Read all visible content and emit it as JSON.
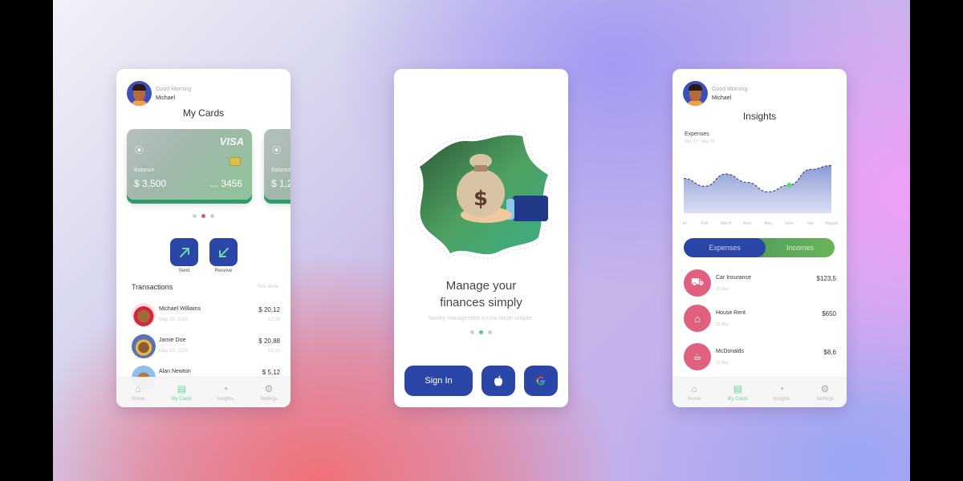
{
  "colors": {
    "primary": "#2a46a6",
    "accent_green": "#6ad8a0",
    "expense_pink": "#e06080",
    "active_dot_pink": "#d0607a",
    "active_dot_green": "#5ac890"
  },
  "screen1": {
    "greeting": "Good Morning",
    "user": "Michael",
    "title": "My Cards",
    "cards": [
      {
        "brand": "VISA",
        "balance_label": "Balance",
        "balance": "$ 3,500",
        "number": "... 3456"
      },
      {
        "brand": "",
        "balance_label": "Balance",
        "balance": "$ 1,2",
        "number": ""
      }
    ],
    "pager": {
      "count": 3,
      "active": 1
    },
    "actions": [
      {
        "label": "Send",
        "icon": "arrow-up-right-icon"
      },
      {
        "label": "Receive",
        "icon": "arrow-down-left-icon"
      }
    ],
    "transactions_title": "Transactions",
    "see_more": "See More",
    "transactions": [
      {
        "name": "Michael Williams",
        "date": "May 25, 2021",
        "amount": "$ 20,12",
        "time": "12:35"
      },
      {
        "name": "Jamie Doe",
        "date": "May 23, 2021",
        "amount": "$ 20,88",
        "time": "15:10"
      },
      {
        "name": "Alan Newton",
        "date": "",
        "amount": "$ 5,12",
        "time": ""
      }
    ],
    "nav": [
      {
        "label": "Home",
        "icon": "home-icon"
      },
      {
        "label": "My Cards",
        "icon": "card-icon",
        "active": true
      },
      {
        "label": "Insights",
        "icon": "pie-chart-icon"
      },
      {
        "label": "Settings",
        "icon": "gear-icon"
      }
    ]
  },
  "screen2": {
    "headline_line1": "Manage your",
    "headline_line2": "finances simply",
    "subtitle": "Money management is now much simpler.",
    "pager": {
      "count": 3,
      "active": 1
    },
    "sign_in": "Sign In",
    "apple_icon": "apple-icon",
    "google_icon": "google-icon"
  },
  "screen3": {
    "greeting": "Good Morning",
    "user": "Michael",
    "title": "Insights",
    "chart_label": "Expenses",
    "chart_range": "May 21 - May 28",
    "chart_data": {
      "type": "area",
      "title": "Expenses",
      "categories": [
        "Jan",
        "Feb",
        "March",
        "April",
        "May",
        "June",
        "July",
        "August"
      ],
      "values": [
        62,
        48,
        70,
        55,
        38,
        50,
        78,
        85
      ],
      "highlight_index": 5,
      "ylim": [
        0,
        100
      ],
      "grid": false
    },
    "tabs": [
      {
        "label": "Expenses",
        "active": true
      },
      {
        "label": "Incomes",
        "active": false
      }
    ],
    "expenses": [
      {
        "name": "Car Insurance",
        "date": "15 May",
        "amount": "$123,5",
        "icon": "car-icon",
        "glyph": "🚗"
      },
      {
        "name": "House Rent",
        "date": "22 May",
        "amount": "$650",
        "icon": "house-icon",
        "glyph": "🏠"
      },
      {
        "name": "McDonalds",
        "date": "23 May",
        "amount": "$8,6",
        "icon": "food-icon",
        "glyph": "🍔"
      }
    ],
    "nav": [
      {
        "label": "Home",
        "icon": "home-icon"
      },
      {
        "label": "My Cards",
        "icon": "card-icon",
        "active": true
      },
      {
        "label": "Insights",
        "icon": "pie-chart-icon"
      },
      {
        "label": "Settings",
        "icon": "gear-icon"
      }
    ]
  }
}
